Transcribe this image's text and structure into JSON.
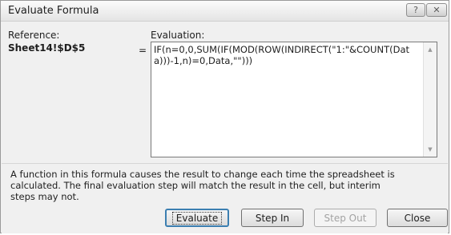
{
  "window": {
    "title": "Evaluate Formula",
    "help_button": "?",
    "close_button": "✕"
  },
  "reference": {
    "label": "Reference:",
    "value": "Sheet14!$D$5",
    "equals": "="
  },
  "evaluation": {
    "label": "Evaluation:",
    "formula": "IF(n=0,0,SUM(IF(MOD(ROW(INDIRECT(\"1:\"&COUNT(Data)))-1,n)=0,Data,\"\")))"
  },
  "info": {
    "message": "A function in this formula causes the result to change each time the spreadsheet is calculated.  The final evaluation step will match the result in the cell, but interim steps may not."
  },
  "buttons": {
    "evaluate": "Evaluate",
    "step_in": "Step In",
    "step_out": "Step Out",
    "close": "Close"
  },
  "scrollbar": {
    "up_icon": "▲",
    "down_icon": "▼"
  }
}
